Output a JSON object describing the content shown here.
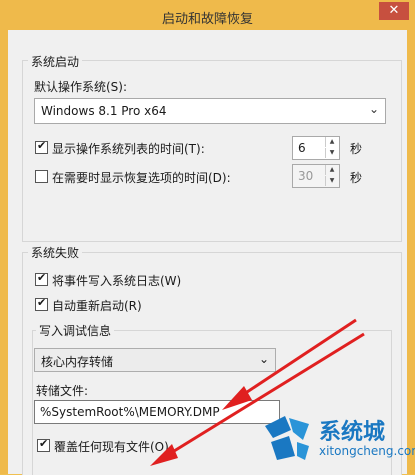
{
  "window": {
    "title": "启动和故障恢复",
    "close_glyph": "✕"
  },
  "startup": {
    "group_label": "系统启动",
    "default_os_label": "默认操作系统(S):",
    "default_os_value": "Windows 8.1 Pro x64",
    "show_list_label": "显示操作系统列表的时间(T):",
    "show_list_checked": true,
    "show_list_value": "6",
    "show_list_unit": "秒",
    "show_recovery_label": "在需要时显示恢复选项的时间(D):",
    "show_recovery_checked": false,
    "show_recovery_value": "30",
    "show_recovery_unit": "秒"
  },
  "failure": {
    "group_label": "系统失败",
    "write_event_label": "将事件写入系统日志(W)",
    "write_event_checked": true,
    "auto_restart_label": "自动重新启动(R)",
    "auto_restart_checked": true,
    "debug_group_label": "写入调试信息",
    "debug_type_value": "核心内存转储",
    "dump_file_label": "转储文件:",
    "dump_file_value": "%SystemRoot%\\MEMORY.DMP",
    "overwrite_label": "覆盖任何现有文件(O)",
    "overwrite_checked": true
  },
  "watermark": {
    "name": "系统城",
    "url": "xitongcheng.com"
  },
  "colors": {
    "frame": "#efba4b",
    "client": "#f0f0f0",
    "arrow": "#e02020",
    "brand": "#1a78c2"
  }
}
